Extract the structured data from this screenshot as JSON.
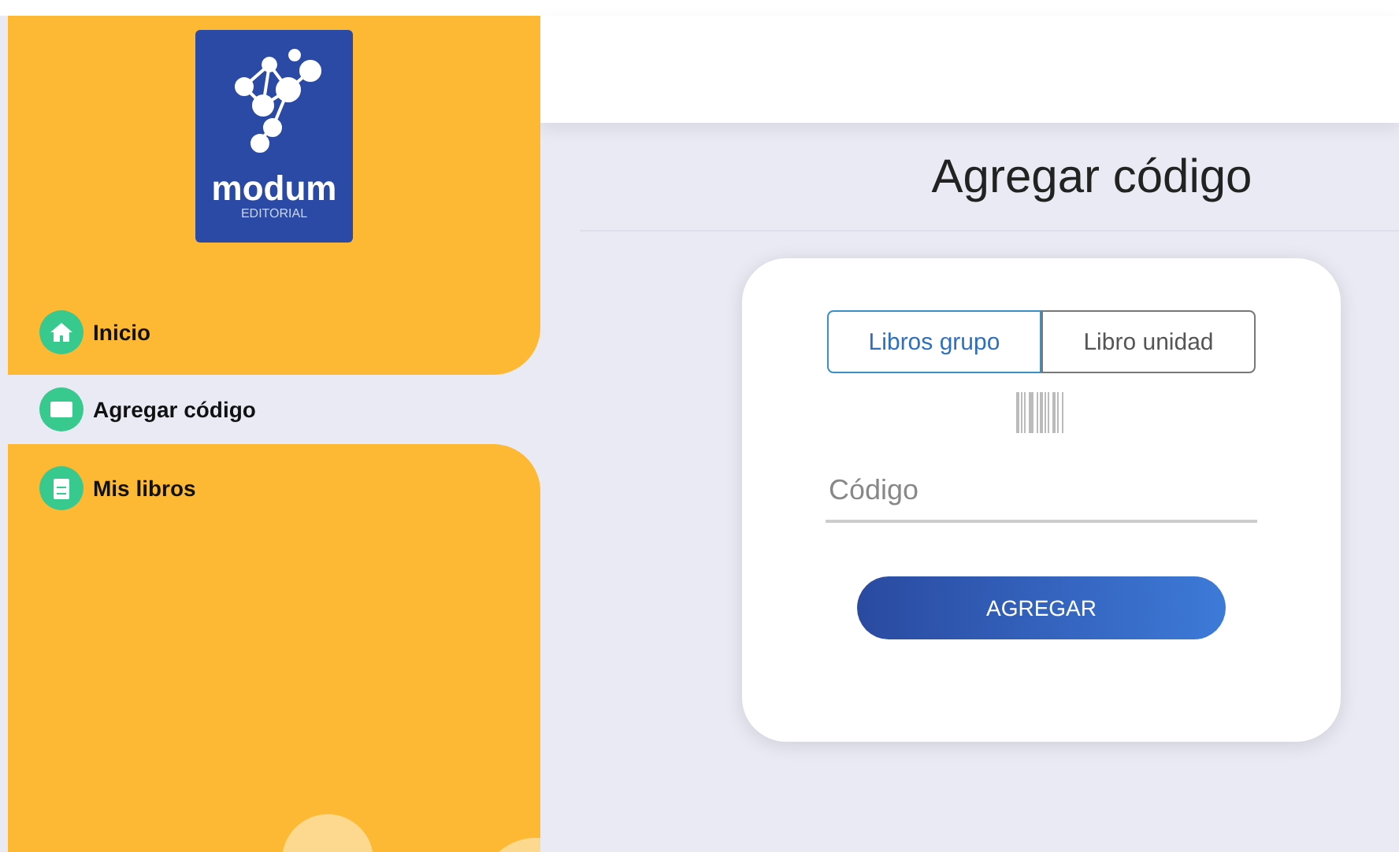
{
  "sidebar": {
    "logo": {
      "name": "modum",
      "subtitle": "EDITORIAL"
    },
    "items": [
      {
        "label": "Inicio",
        "selected": false
      },
      {
        "label": "Agregar código",
        "selected": true
      },
      {
        "label": "Mis libros",
        "selected": false
      }
    ]
  },
  "page": {
    "title": "Agregar código"
  },
  "form": {
    "tabs": [
      {
        "label": "Libros grupo",
        "selected": true
      },
      {
        "label": "Libro unidad",
        "selected": false
      }
    ],
    "code_field": {
      "placeholder": "Código"
    },
    "submit": "AGREGAR"
  }
}
